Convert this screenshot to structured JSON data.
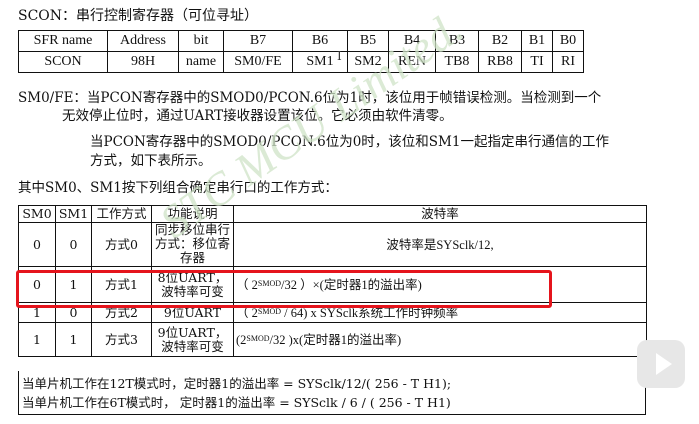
{
  "scon_title": "SCON：串行控制寄存器（可位寻址）",
  "reg_table": {
    "headers": [
      "SFR name",
      "Address",
      "bit",
      "B7",
      "B6",
      "B5",
      "B4",
      "B3",
      "B2",
      "B1",
      "B0"
    ],
    "row": [
      "SCON",
      "98H",
      "name",
      "SM0/FE",
      "SM1",
      "SM2",
      "REN",
      "TB8",
      "RB8",
      "TI",
      "RI"
    ]
  },
  "desc": {
    "line1": "SM0/FE：当PCON寄存器中的SMOD0/PCON.6位为1时，该位用于帧错误检测。当检测到一个",
    "line2": "无效停止位时，通过UART接收器设置该位。它必须由软件清零。",
    "line3": "当PCON寄存器中的SMOD0/PCON.6位为0时，该位和SM1一起指定串行通信的工作",
    "line4": "方式，如下表所示。",
    "line5": "其中SM0、SM1按下列组合确定串行口的工作方式："
  },
  "mode_table": {
    "headers": [
      "SM0",
      "SM1",
      "工作方式",
      "功能说明",
      "波特率"
    ],
    "rows": [
      {
        "sm0": "0",
        "sm1": "0",
        "mode": "方式0",
        "func": "同步移位串行方式：移位寄存器",
        "rate": "波特率是SYSclk/12,"
      },
      {
        "sm0": "0",
        "sm1": "1",
        "mode": "方式1",
        "func": "8位UART，波特率可变",
        "rate_prefix": "（ 2",
        "rate_sup": "SMOD",
        "rate_suffix": "/32 ）×(定时器1的溢出率)"
      },
      {
        "sm0": "1",
        "sm1": "0",
        "mode": "方式2",
        "func": "9位UART",
        "rate_prefix": "（ 2",
        "rate_sup": "SMOD",
        "rate_suffix": " / 64) x SYSclk系统工作时钟频率"
      },
      {
        "sm0": "1",
        "sm1": "1",
        "mode": "方式3",
        "func": "9位UART，波特率可变",
        "rate_prefix": "(2",
        "rate_sup": "SMOD",
        "rate_suffix": "/32 )x(定时器1的溢出率)"
      }
    ]
  },
  "footer": {
    "line1": "当单片机工作在12T模式时，定时器1的溢出率 = SYSclk/12/( 256 - T H1);",
    "line2": "当单片机工作在6T模式时，  定时器1的溢出率 = SYSclk / 6 / ( 256 - T H1)"
  },
  "watermark": "STC MCU Limited.",
  "colors": {
    "highlight": "#e5141c",
    "watermark": "#cfe3c7"
  }
}
